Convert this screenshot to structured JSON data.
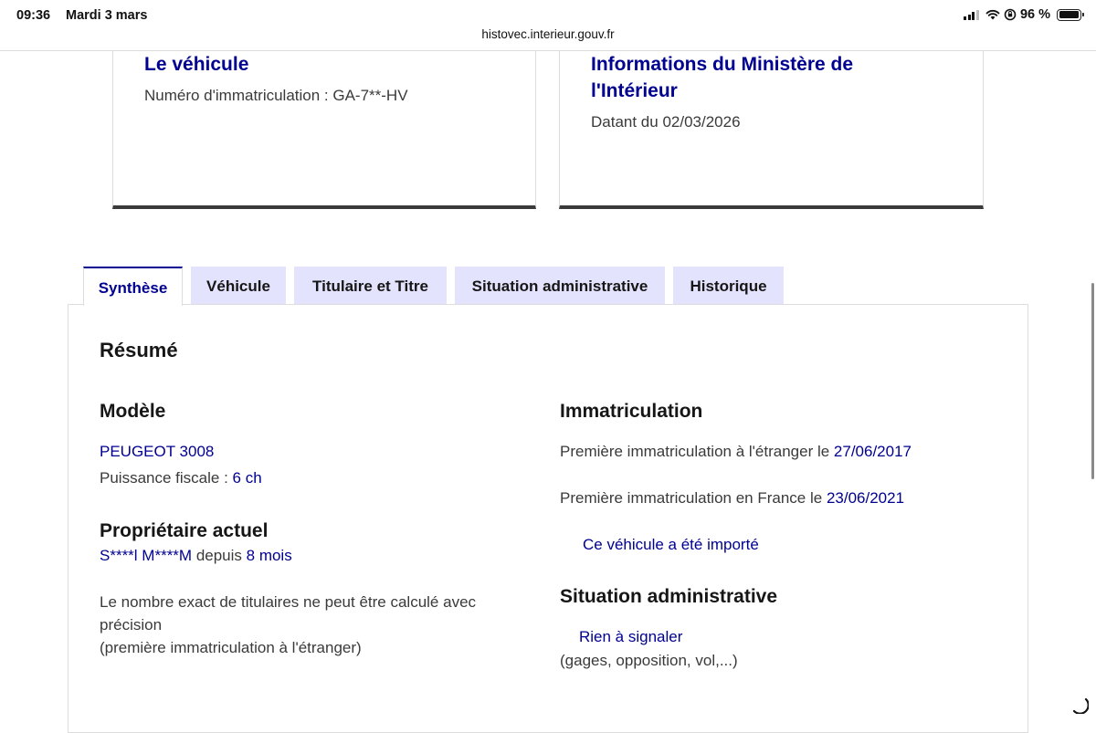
{
  "status_bar": {
    "time": "09:36",
    "date": "Mardi 3 mars",
    "battery": "96 %"
  },
  "url": "histovec.interieur.gouv.fr",
  "vehicle_card": {
    "title": "Le véhicule",
    "plate_text": "Numéro d'immatriculation : GA-7**-HV"
  },
  "ministry_card": {
    "title_line1": "Informations du Ministère de",
    "title_line2": "l'Intérieur",
    "date_text": "Datant du 02/03/2026"
  },
  "tabs": [
    {
      "label": "Synthèse",
      "active": true
    },
    {
      "label": "Véhicule",
      "active": false
    },
    {
      "label": "Titulaire et Titre",
      "active": false
    },
    {
      "label": "Situation administrative",
      "active": false
    },
    {
      "label": "Historique",
      "active": false
    }
  ],
  "summary": {
    "heading": "Résumé",
    "model": {
      "heading": "Modèle",
      "name": "PEUGEOT 3008",
      "power_label": "Puissance fiscale : ",
      "power_value": "6 ch"
    },
    "owner": {
      "heading": "Propriétaire actuel",
      "name": "S****l M****M",
      "since_label": " depuis ",
      "since_value": "8 mois",
      "note_line1": "Le nombre exact de titulaires ne peut être calculé avec",
      "note_line2": "précision",
      "note_line3": "(première immatriculation à l'étranger)"
    },
    "registration": {
      "heading": "Immatriculation",
      "foreign_label": "Première immatriculation à l'étranger le ",
      "foreign_date": "27/06/2017",
      "france_label": "Première immatriculation en France le ",
      "france_date": "23/06/2021",
      "imported_text": "Ce véhicule a été importé"
    },
    "admin": {
      "heading": "Situation administrative",
      "status": "Rien à signaler",
      "detail": "(gages, opposition, vol,...)"
    }
  }
}
